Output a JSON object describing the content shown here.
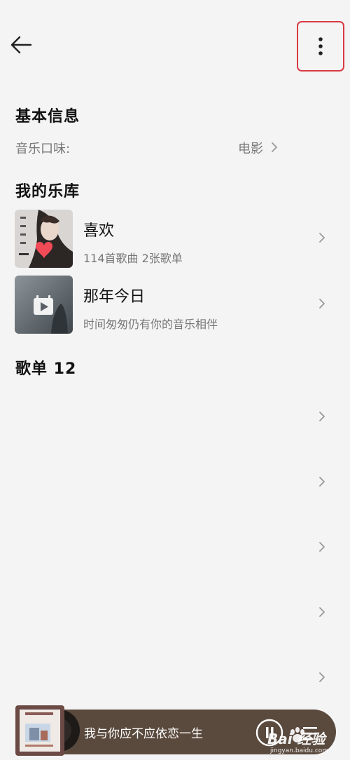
{
  "header": {
    "back_icon": "arrow-left-icon",
    "more_icon": "more-vertical-icon",
    "highlight_color": "#d93a44"
  },
  "basic_info": {
    "title": "基本信息",
    "taste_label": "音乐口味:",
    "taste_value": "电影"
  },
  "library": {
    "title": "我的乐库",
    "items": [
      {
        "title": "喜欢",
        "subtitle": "114首歌曲 2张歌单",
        "thumb_icon": "heart-icon"
      },
      {
        "title": "那年今日",
        "subtitle": "时间匆匆仍有你的音乐相伴",
        "thumb_icon": "calendar-play-icon"
      }
    ]
  },
  "playlists": {
    "title": "歌单 12",
    "rows": 5
  },
  "player": {
    "song": "我与你应不应依恋一生",
    "play_icon": "play-icon",
    "list_icon": "playlist-icon",
    "bg_color": "#5a4a3e"
  },
  "watermark": {
    "text": "Bai 经验",
    "url": "jingyan.baidu.com"
  }
}
